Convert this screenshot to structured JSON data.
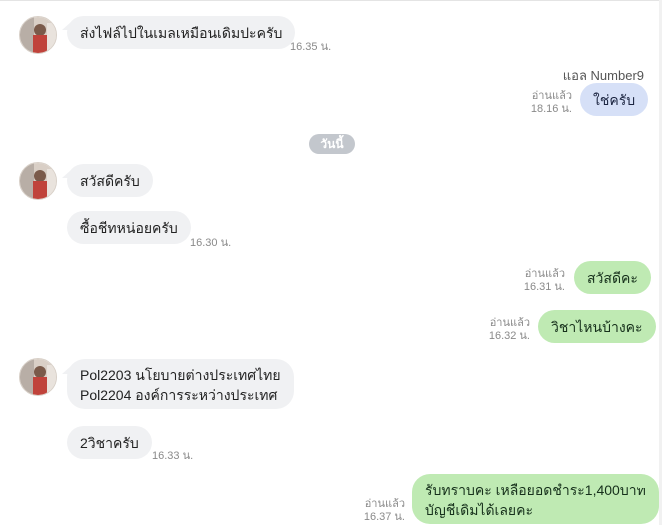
{
  "date_divider": "วันนี้",
  "outgoing_sender": "แอล Number9",
  "messages": [
    {
      "text": "ส่งไฟล์ไปในเมลเหมือนเดิมปะครับ",
      "time": "16.35 น."
    },
    {
      "text": "ใช่ครับ",
      "read": "อ่านแล้ว",
      "time": "18.16 น."
    },
    {
      "text": "สวัสดีครับ"
    },
    {
      "text": "ซื้อชีทหน่อยครับ",
      "time": "16.30 น."
    },
    {
      "text": "สวัสดีคะ",
      "read": "อ่านแล้ว",
      "time": "16.31 น."
    },
    {
      "text": "วิชาไหนบ้างคะ",
      "read": "อ่านแล้ว",
      "time": "16.32 น."
    },
    {
      "lines": [
        "Pol2203 นโยบายต่างประเทศไทย",
        "Pol2204 องค์การระหว่างประเทศ"
      ]
    },
    {
      "text": "2วิชาครับ",
      "time": "16.33 น."
    },
    {
      "lines": [
        "รับทราบคะ เหลือยอดชำระ1,400บาท",
        "บัญชีเดิมได้เลยคะ"
      ],
      "read": "อ่านแล้ว",
      "time": "16.37 น."
    }
  ],
  "colors": {
    "incoming_bubble": "#f0f1f3",
    "outgoing_blue": "#d6e0f7",
    "outgoing_green": "#bfeab3",
    "date_chip": "#c3c7cd"
  }
}
